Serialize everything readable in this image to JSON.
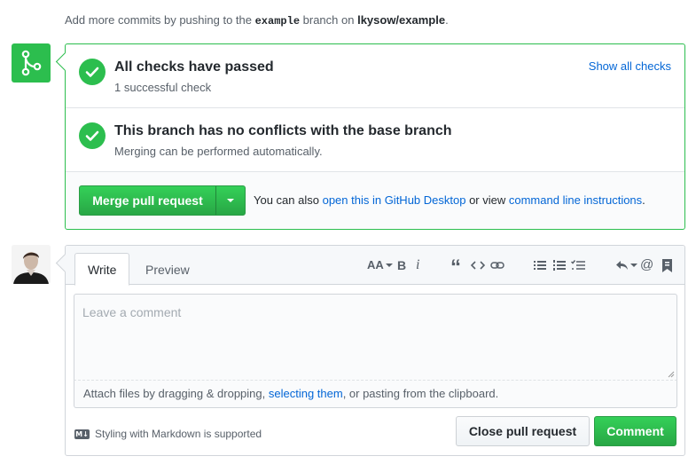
{
  "hint": {
    "prefix": "Add more commits by pushing to the ",
    "branch": "example",
    "middle": " branch on ",
    "repo": "lkysow/example",
    "suffix": "."
  },
  "checks": {
    "title": "All checks have passed",
    "subtitle": "1 successful check",
    "show_all": "Show all checks"
  },
  "conflicts": {
    "title": "This branch has no conflicts with the base branch",
    "subtitle": "Merging can be performed automatically."
  },
  "merge": {
    "button_label": "Merge pull request",
    "also_prefix": "You can also ",
    "desktop_link": "open this in GitHub Desktop",
    "also_middle": " or view ",
    "cli_link": "command line instructions",
    "also_suffix": "."
  },
  "editor": {
    "tabs": {
      "write": "Write",
      "preview": "Preview"
    },
    "toolbar": {
      "heading": "AA",
      "bold": "B",
      "italic": "i",
      "quote": "“",
      "mention": "@"
    },
    "placeholder": "Leave a comment",
    "attach_prefix": "Attach files by dragging & dropping, ",
    "attach_link": "selecting them",
    "attach_suffix": ", or pasting from the clipboard.",
    "md_icon": "M↓",
    "markdown_note": "Styling with Markdown is supported",
    "close_button": "Close pull request",
    "comment_button": "Comment"
  },
  "colors": {
    "success": "#2cbe4e",
    "link": "#0366d6",
    "border": "#d1d5da"
  },
  "icons": {
    "merge_status": "git-merge-icon",
    "check": "check-icon",
    "avatar": "user-avatar"
  }
}
